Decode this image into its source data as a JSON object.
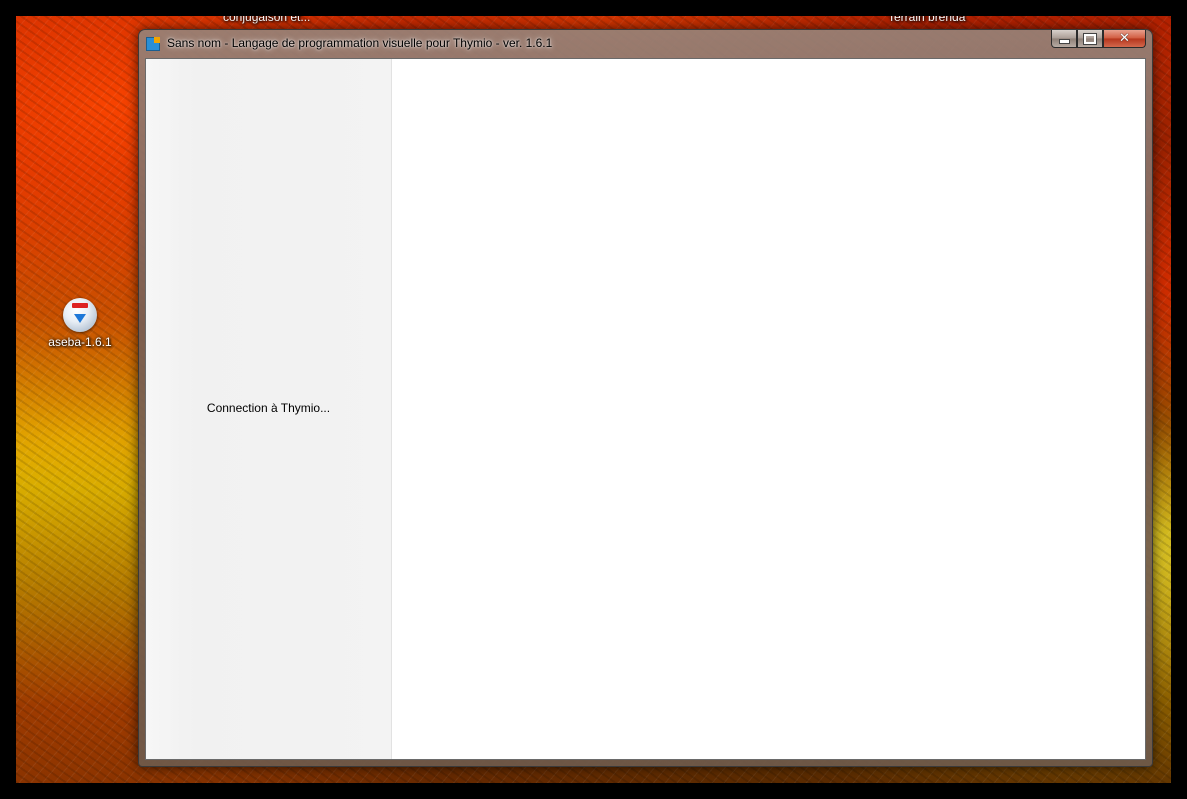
{
  "desktop": {
    "top_icons": [
      {
        "label": "conjugaison et..."
      },
      {
        "label": "Terrain brenda"
      }
    ],
    "icons": [
      {
        "label": "aseba-1.6.1",
        "icon": "installer-disc-icon"
      }
    ]
  },
  "window": {
    "title": "Sans nom - Langage de programmation visuelle pour Thymio - ver. 1.6.1",
    "app_icon": "thymio-vpl-icon",
    "controls": {
      "minimize": "minimize-icon",
      "maximize": "maximize-icon",
      "close": "close-icon"
    }
  },
  "main": {
    "left_panel": {
      "status": "Connection à Thymio..."
    }
  },
  "colors": {
    "close_button": "#c8452a",
    "client_background": "#ffffff",
    "left_panel_background": "#f3f3f3"
  }
}
